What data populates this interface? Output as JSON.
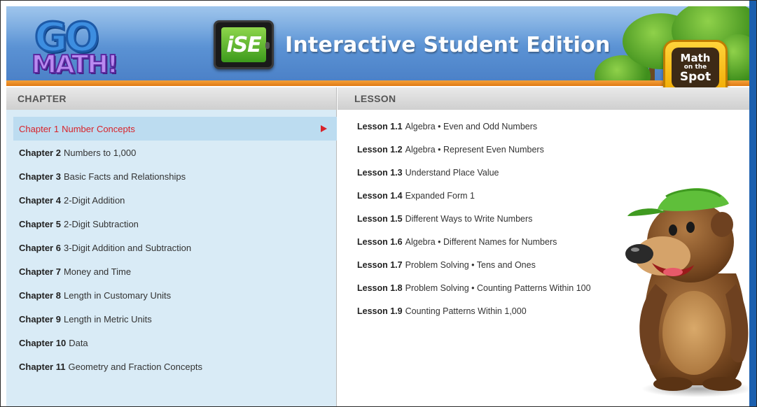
{
  "header": {
    "logo_top": "GO",
    "logo_bottom": "MATH!",
    "ise_badge": "iSE",
    "title": "Interactive Student Edition",
    "spot_line1": "Math",
    "spot_line2": "on the",
    "spot_line3": "Spot"
  },
  "columns": {
    "chapter_heading": "CHAPTER",
    "lesson_heading": "LESSON"
  },
  "chapters": [
    {
      "num": "Chapter 1",
      "title": "Number Concepts",
      "selected": true
    },
    {
      "num": "Chapter 2",
      "title": "Numbers to 1,000"
    },
    {
      "num": "Chapter 3",
      "title": "Basic Facts and Relationships"
    },
    {
      "num": "Chapter 4",
      "title": "2-Digit Addition"
    },
    {
      "num": "Chapter 5",
      "title": "2-Digit Subtraction"
    },
    {
      "num": "Chapter 6",
      "title": "3-Digit Addition and Subtraction"
    },
    {
      "num": "Chapter 7",
      "title": "Money and Time"
    },
    {
      "num": "Chapter 8",
      "title": "Length in Customary Units"
    },
    {
      "num": "Chapter 9",
      "title": "Length in Metric Units"
    },
    {
      "num": "Chapter 10",
      "title": "Data"
    },
    {
      "num": "Chapter 11",
      "title": "Geometry and Fraction Concepts"
    }
  ],
  "lessons": [
    {
      "num": "Lesson 1.1",
      "title": "Algebra • Even and Odd Numbers"
    },
    {
      "num": "Lesson 1.2",
      "title": "Algebra • Represent Even Numbers"
    },
    {
      "num": "Lesson 1.3",
      "title": "Understand Place Value"
    },
    {
      "num": "Lesson 1.4",
      "title": "Expanded Form 1"
    },
    {
      "num": "Lesson 1.5",
      "title": "Different Ways to Write Numbers"
    },
    {
      "num": "Lesson 1.6",
      "title": "Algebra • Different Names for Numbers"
    },
    {
      "num": "Lesson 1.7",
      "title": "Problem Solving • Tens and Ones"
    },
    {
      "num": "Lesson 1.8",
      "title": "Problem Solving • Counting Patterns Within 100"
    },
    {
      "num": "Lesson 1.9",
      "title": "Counting Patterns Within 1,000"
    }
  ],
  "colors": {
    "accent_red": "#d8232a",
    "chapter_panel_bg": "#d9ebf6",
    "selected_row_bg": "#bcdcf0",
    "header_blue": "#5d95d6",
    "orange_bar": "#e07a14"
  },
  "icons": {
    "selected_indicator": "play-arrow-icon",
    "mascot": "bear-mascot"
  }
}
